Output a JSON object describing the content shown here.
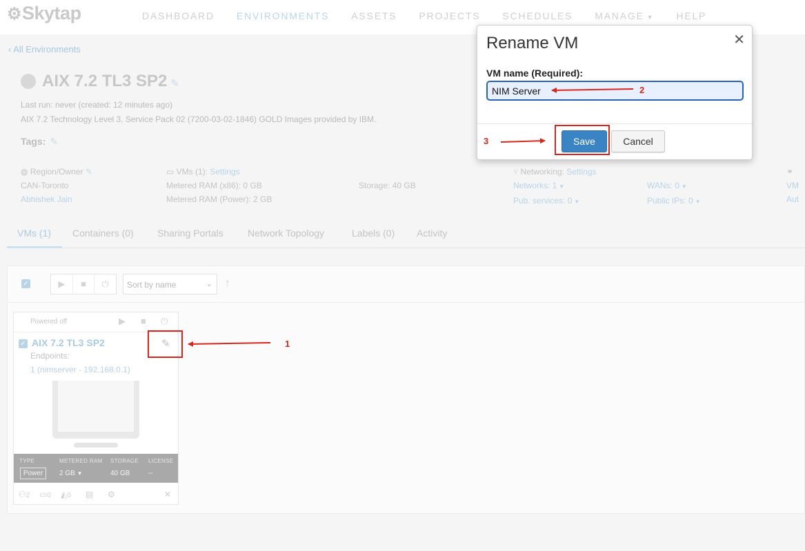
{
  "nav": {
    "logo": "Skytap",
    "items": [
      "DASHBOARD",
      "ENVIRONMENTS",
      "ASSETS",
      "PROJECTS",
      "SCHEDULES",
      "MANAGE",
      "HELP"
    ],
    "active": "ENVIRONMENTS"
  },
  "environment": {
    "back_link": "All Environments",
    "title": "AIX 7.2 TL3 SP2",
    "last_run_label": "Last run:",
    "last_run_value": "never (created: 12 minutes ago)",
    "description": "AIX 7.2 Technology Level 3, Service Pack 02 (7200-03-02-1846) GOLD Images provided by IBM.",
    "tags_label": "Tags:"
  },
  "info": {
    "region_label": "Region/Owner",
    "region": "CAN-Toronto",
    "owner": "Abhishek Jain",
    "vms_label": "VMs (1):",
    "vms_settings": "Settings",
    "ram_x86": "Metered RAM (x86): 0 GB",
    "ram_power": "Metered RAM (Power): 2 GB",
    "storage": "Storage: 40 GB",
    "networking_label": "Networking:",
    "networking_settings": "Settings",
    "networks": "Networks: 1",
    "pub_services": "Pub. services: 0",
    "wans": "WANs: 0",
    "public_ips": "Public IPs: 0",
    "cut_vm": "VM",
    "cut_aut": "Aut"
  },
  "tabs": [
    "VMs (1)",
    "Containers (0)",
    "Sharing Portals",
    "Network Topology",
    "Labels (0)",
    "Activity"
  ],
  "toolbar": {
    "sort_value": "Sort by name"
  },
  "vm": {
    "status": "Powered off",
    "name": "AIX 7.2 TL3 SP2",
    "endpoints_label": "Endpoints:",
    "endpoint": "1 (nimserver - 192.168.0.1)",
    "meta_headers": [
      "TYPE",
      "METERED RAM",
      "STORAGE",
      "LICENSE"
    ],
    "type": "Power",
    "ram": "2 GB",
    "storage": "40 GB",
    "license": "--",
    "foot_counts": [
      "2",
      "0",
      "0"
    ]
  },
  "modal": {
    "title": "Rename VM",
    "label": "VM name (Required):",
    "input_value": "NIM Server",
    "save": "Save",
    "cancel": "Cancel"
  },
  "annotations": {
    "one": "1",
    "two": "2",
    "three": "3",
    "color": "#d9261c"
  }
}
